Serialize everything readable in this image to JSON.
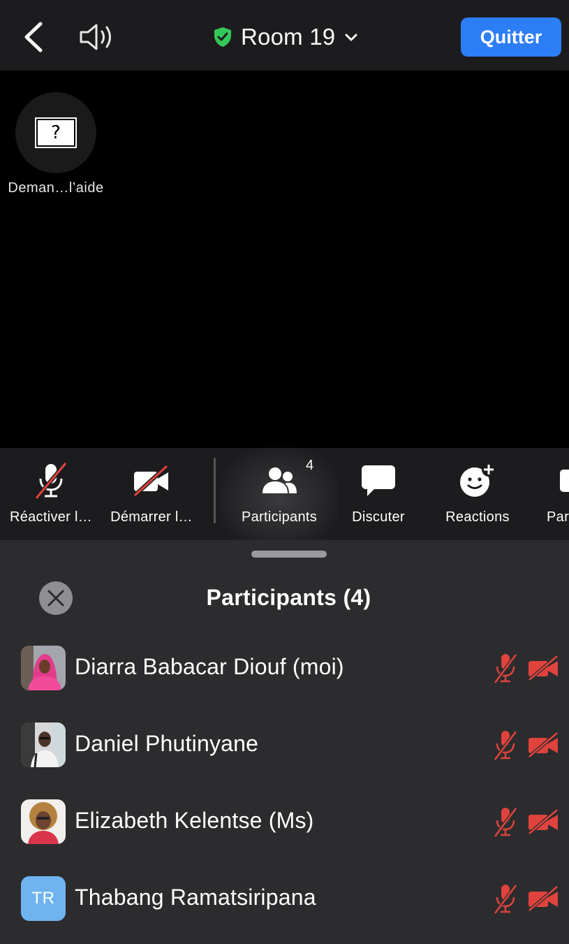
{
  "header": {
    "room_title": "Room 19",
    "quit_label": "Quitter"
  },
  "video": {
    "help_symbol": "?",
    "help_label": "Deman…l’aide"
  },
  "toolbar": {
    "unmute_label": "Réactiver l…",
    "start_video_label": "Démarrer l…",
    "participants_label": "Participants",
    "participants_badge": "4",
    "chat_label": "Discuter",
    "reactions_label": "Reactions",
    "share_label": "Par"
  },
  "panel": {
    "title": "Participants (4)",
    "participants": [
      {
        "name": "Diarra Babacar Diouf  (moi)"
      },
      {
        "name": "Daniel Phutinyane"
      },
      {
        "name": "Elizabeth Kelentse (Ms)"
      },
      {
        "name": "Thabang Ramatsiripana",
        "initials": "TR"
      }
    ]
  },
  "colors": {
    "accent": "#2d7df6",
    "muted_red": "#e0433d",
    "shield_green": "#34c759",
    "avatar_blue": "#6fb4f0"
  }
}
